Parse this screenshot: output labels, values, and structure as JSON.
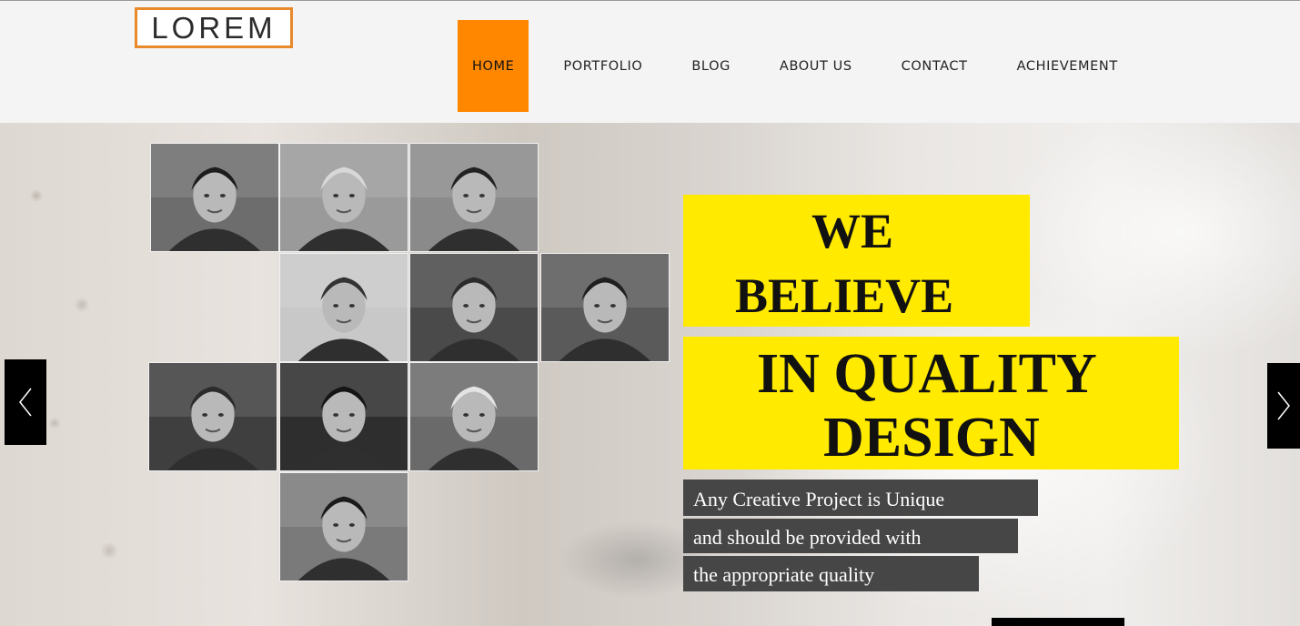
{
  "brand": {
    "logo_text": "LOREM",
    "logo_border_color": "#e88a2c"
  },
  "nav": {
    "items": [
      {
        "label": "HOME",
        "active": true
      },
      {
        "label": "PORTFOLIO",
        "active": false
      },
      {
        "label": "BLOG",
        "active": false
      },
      {
        "label": "ABOUT US",
        "active": false
      },
      {
        "label": "CONTACT",
        "active": false
      },
      {
        "label": "ACHIEVEMENT",
        "active": false
      }
    ],
    "active_color": "#ff8700"
  },
  "hero": {
    "headline_lines": [
      "WE",
      "BELIEVE",
      "IN QUALITY",
      "DESIGN"
    ],
    "subtext_lines": [
      "Any Creative Project is Unique",
      "and should be provided with",
      "the appropriate quality"
    ],
    "highlight_color": "#ffea00",
    "subtext_bg_color": "#474646",
    "prev_icon": "chevron-left-icon",
    "next_icon": "chevron-right-icon"
  },
  "team_photos": {
    "count": 10,
    "style": "grayscale portraits"
  }
}
